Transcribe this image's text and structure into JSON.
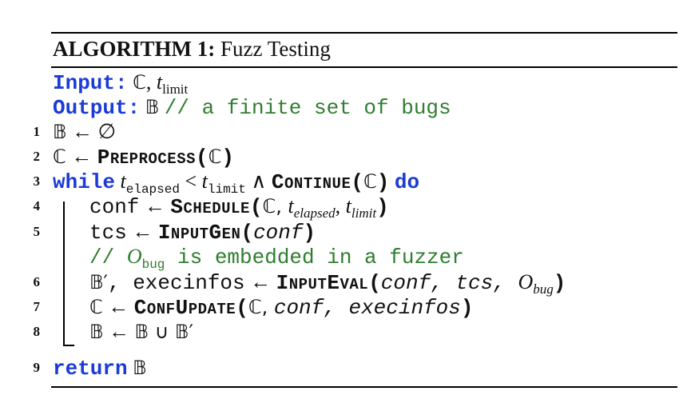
{
  "algorithm": {
    "label": "ALGORITHM 1:",
    "name": "Fuzz Testing"
  },
  "input": {
    "keyword": "Input:",
    "C": "ℂ",
    "comma": ",",
    "t": "t",
    "t_sub": "limit"
  },
  "output": {
    "keyword": "Output:",
    "B": "𝔹",
    "comment": "// a finite set of bugs"
  },
  "lines": [
    {
      "num": "1"
    },
    {
      "num": "2"
    },
    {
      "num": "3"
    },
    {
      "num": "4"
    },
    {
      "num": "5"
    },
    {
      "num": "6"
    },
    {
      "num": "7"
    },
    {
      "num": "8"
    },
    {
      "num": "9"
    }
  ],
  "l1": {
    "lhs": "𝔹",
    "arrow": "←",
    "rhs": "∅"
  },
  "l2": {
    "lhs": "ℂ",
    "arrow": "←",
    "fn_cap": "P",
    "fn_rest": "REPROCESS",
    "open": "(",
    "arg": "ℂ",
    "close": ")"
  },
  "l3": {
    "while": "while",
    "t": "t",
    "t_sub": "elapsed",
    "lt": "<",
    "t2": "t",
    "t2_sub": "limit",
    "and": "∧",
    "fn_cap": "C",
    "fn_rest": "ONTINUE",
    "open": "(",
    "arg": "ℂ",
    "close": ")",
    "do": "do"
  },
  "l4": {
    "lhs": "conf",
    "arrow": "←",
    "fn_cap": "S",
    "fn_rest": "CHEDULE",
    "open": "(",
    "arg1": "ℂ, ",
    "t": "t",
    "t_sub": "elapsed",
    "sep": ", ",
    "t2": "t",
    "t2_sub": "limit",
    "close": ")"
  },
  "l5": {
    "lhs": "tcs",
    "arrow": "←",
    "fn_cap": "I",
    "fn_rest": "NPUT",
    "fn_cap2": "G",
    "fn_rest2": "EN",
    "open": "(",
    "arg": "conf",
    "close": ")"
  },
  "comment_line": {
    "prefix": "// ",
    "O": "O",
    "O_sub": "bug",
    "rest": " is embedded in a fuzzer"
  },
  "l6": {
    "lhs": "𝔹′",
    "lhs2": ", execinfos",
    "arrow": "←",
    "fn_cap": "I",
    "fn_rest": "NPUT",
    "fn_cap2": "E",
    "fn_rest2": "VAL",
    "open": "(",
    "args": "conf, tcs, ",
    "O": "O",
    "O_sub": "bug",
    "close": ")"
  },
  "l7": {
    "lhs": "ℂ",
    "arrow": "←",
    "fn_cap": "C",
    "fn_rest": "ONF",
    "fn_cap2": "U",
    "fn_rest2": "PDATE",
    "open": "(",
    "arg1": "ℂ, ",
    "args": "conf, execinfos",
    "close": ")"
  },
  "l8": {
    "lhs": "𝔹",
    "arrow": "←",
    "rhs": "𝔹 ∪ 𝔹′"
  },
  "l9": {
    "ret": "return",
    "val": "𝔹"
  }
}
